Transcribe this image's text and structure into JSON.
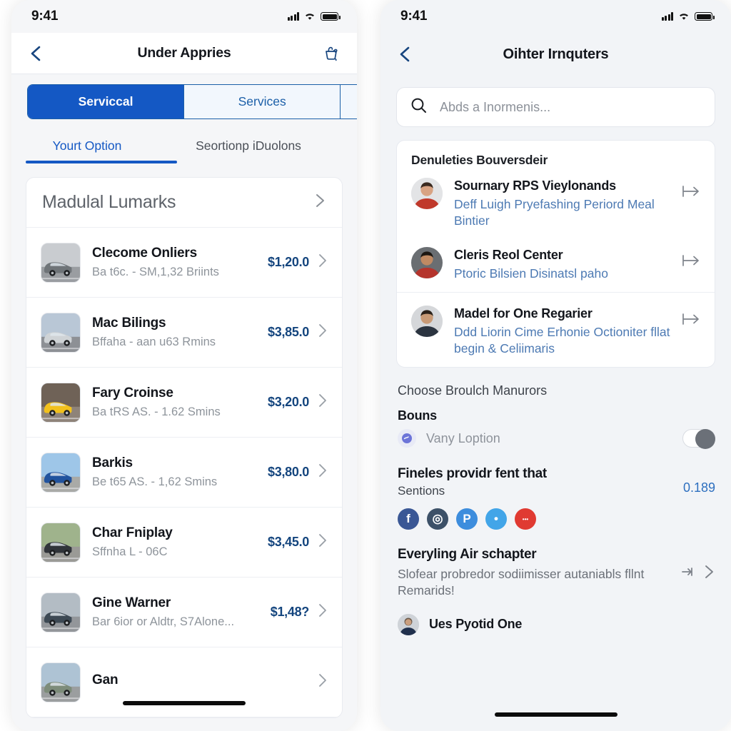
{
  "left": {
    "status": {
      "time": "9:41",
      "icons": [
        "cellular-signal",
        "wifi",
        "battery"
      ]
    },
    "nav": {
      "title": "Under Appries",
      "back_icon": "back-chevron-icon",
      "action_icon": "basket-icon"
    },
    "segmented": {
      "items": [
        "Serviccal",
        "Services",
        ""
      ],
      "selected_index": 0
    },
    "tabs": {
      "items": [
        "Yourt Option",
        "Seortionp iDuolons"
      ],
      "selected_index": 0
    },
    "list": {
      "header": "Madulal Lumarks",
      "header_chevron": "chevron-right-icon",
      "rows": [
        {
          "title": "Clecome Onliers",
          "subtitle": "Ba t6c. - SM,1,32 Briints",
          "price": "$1,20.0"
        },
        {
          "title": "Mac Bilings",
          "subtitle": "Bffaha - aan u63 Rmins",
          "price": "$3,85.0"
        },
        {
          "title": "Fary Croinse",
          "subtitle": "Ba tRS AS. - 1.62 Smins",
          "price": "$3,20.0"
        },
        {
          "title": "Barkis",
          "subtitle": "Be t65 AS. - 1,62 Smins",
          "price": "$3,80.0"
        },
        {
          "title": "Char Fniplay",
          "subtitle": "Sffnha L - 06C",
          "price": "$3,45.0"
        },
        {
          "title": "Gine Warner",
          "subtitle": "Bar 6ior or Aldtr, S7Alone...",
          "price": "$1,48?"
        },
        {
          "title": "Gan",
          "subtitle": "",
          "price": ""
        }
      ]
    }
  },
  "right": {
    "status": {
      "time": "9:41",
      "icons": [
        "cellular-signal",
        "wifi",
        "battery"
      ]
    },
    "nav": {
      "title": "Oihter Irnquters",
      "back_icon": "back-chevron-icon"
    },
    "search": {
      "placeholder": "Abds a Inormenis...",
      "value": "",
      "icon": "search-icon"
    },
    "contacts": {
      "title": "Denuleties Bouversdeir",
      "items": [
        {
          "name": "Sournary RPS Vieylonands",
          "desc": "Deff Luigh Pryefashing Periord Meal Bintier",
          "action_icon": "forward-arrow-icon"
        },
        {
          "name": "Cleris Reol Center",
          "desc": "Ptoric Bilsien Disinatsl paho",
          "action_icon": "forward-arrow-icon"
        },
        {
          "name": "Madel for One Regarier",
          "desc": "Ddd Liorin Cime Erhonie Octioniter fllat begin & Celiimaris",
          "action_icon": "forward-arrow-icon"
        }
      ]
    },
    "section_label": "Choose Broulch Manurors",
    "bonus": {
      "heading": "Bouns",
      "toggle_label": "Vany Loption",
      "toggle_on": true,
      "icon": "badge-icon"
    },
    "metric": {
      "title": "Fineles providr fent that",
      "subtitle": "Sentions",
      "value": "0.189"
    },
    "socials": [
      {
        "name": "facebook-icon",
        "color": "#3a5795",
        "glyph": "f"
      },
      {
        "name": "instagram-icon",
        "color": "#3d5168",
        "glyph": "◎"
      },
      {
        "name": "pinterest-icon",
        "color": "#3d8ddd",
        "glyph": "P"
      },
      {
        "name": "twitter-icon",
        "color": "#42a5e8",
        "glyph": "•"
      },
      {
        "name": "more-icon",
        "color": "#e03a32",
        "glyph": "•••"
      }
    ],
    "promo": {
      "title": "Everyling Air schapter",
      "desc": "Slofear probredor sodiimisser autaniabls fllnt Remarids!",
      "icons": [
        "pin-icon",
        "chevron-right-icon"
      ]
    },
    "footer_user": {
      "name": "Ues Pyotid One",
      "avatar": "user-avatar"
    }
  },
  "colors": {
    "accent_blue": "#1458c4",
    "link_blue": "#4d7ab3",
    "price_navy": "#14457e",
    "panel_bg": "#f2f4f7"
  }
}
